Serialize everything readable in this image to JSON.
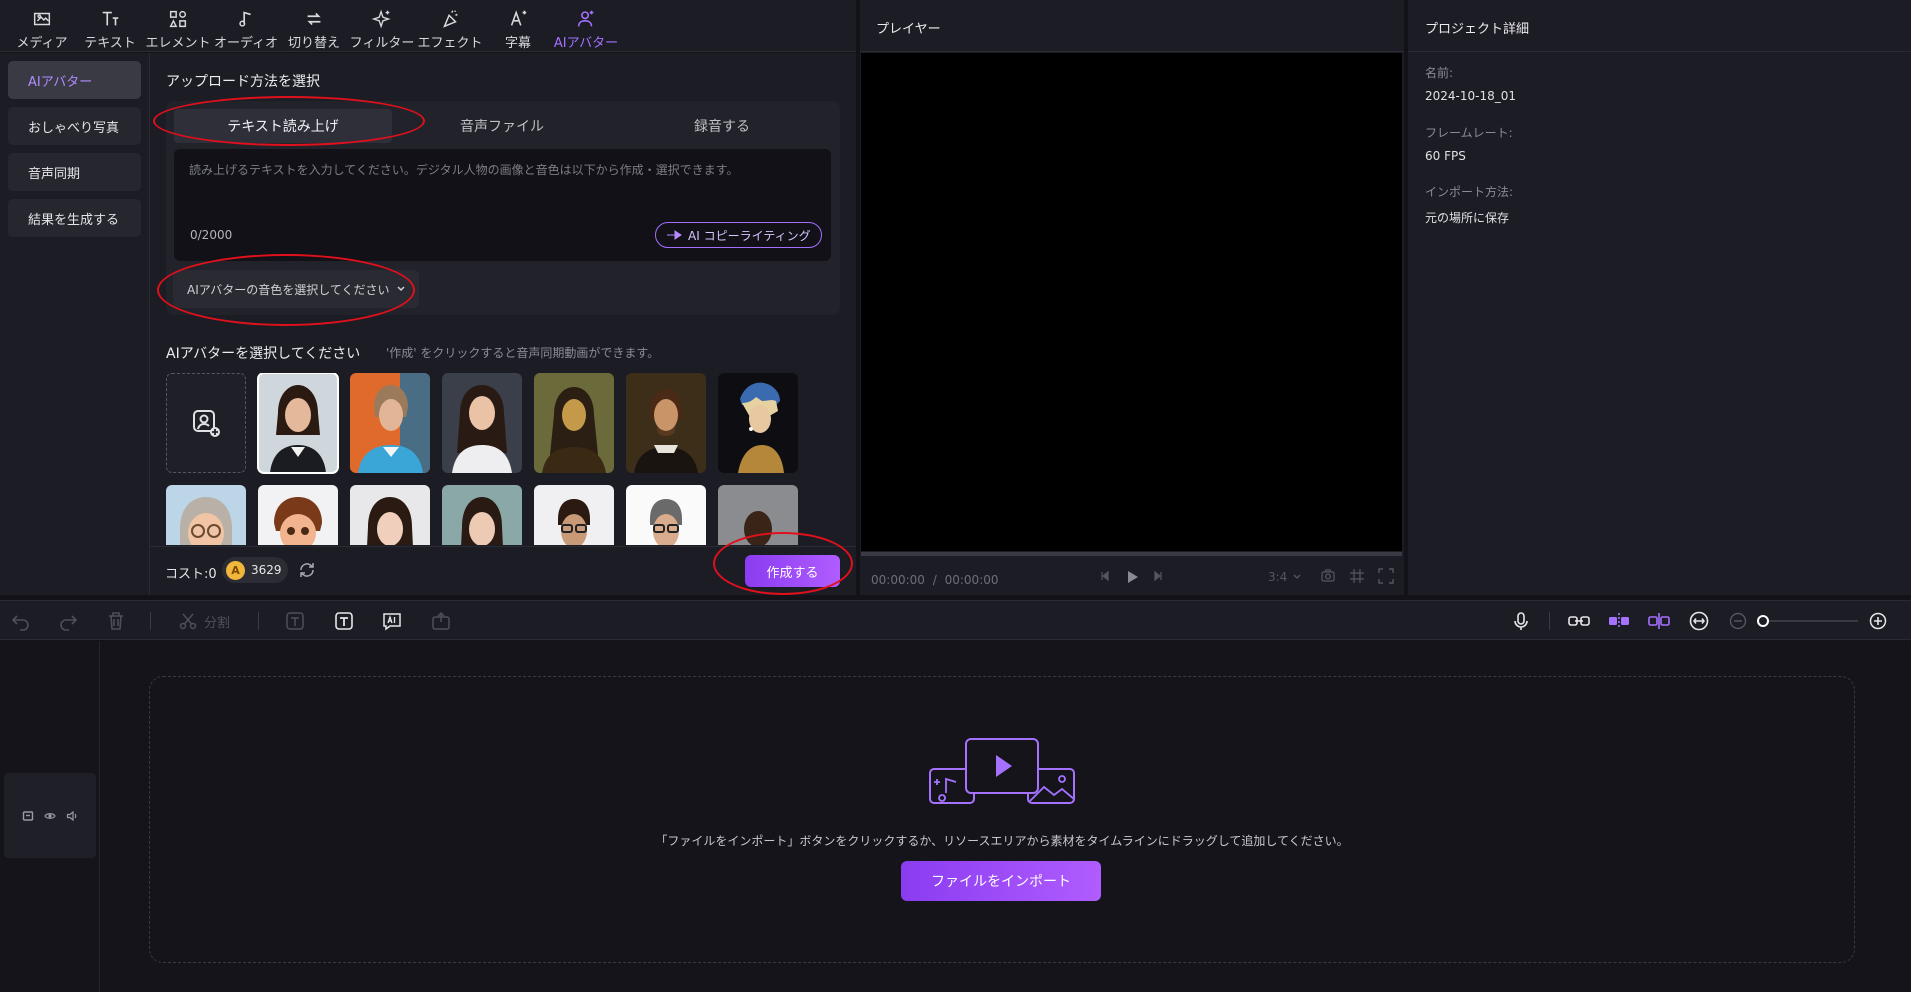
{
  "nav": [
    {
      "label": "メディア",
      "icon": "media-icon"
    },
    {
      "label": "テキスト",
      "icon": "text-icon"
    },
    {
      "label": "エレメント",
      "icon": "element-icon"
    },
    {
      "label": "オーディオ",
      "icon": "audio-icon"
    },
    {
      "label": "切り替え",
      "icon": "transition-icon"
    },
    {
      "label": "フィルター",
      "icon": "filter-icon"
    },
    {
      "label": "エフェクト",
      "icon": "effect-icon"
    },
    {
      "label": "字幕",
      "icon": "subtitle-icon"
    },
    {
      "label": "AIアバター",
      "icon": "ai-avatar-icon",
      "active": true
    }
  ],
  "sidebar": {
    "items": [
      {
        "label": "AIアバター",
        "active": true
      },
      {
        "label": "おしゃべり写真"
      },
      {
        "label": "音声同期"
      },
      {
        "label": "結果を生成する"
      }
    ]
  },
  "upload": {
    "title": "アップロード方法を選択",
    "tabs": [
      "テキスト読み上げ",
      "音声ファイル",
      "録音する"
    ],
    "active_tab": 0,
    "placeholder": "読み上げるテキストを入力してください。デジタル人物の画像と音色は以下から作成・選択できます。",
    "counter": "0/2000",
    "ai_copy": "AI コピーライティング",
    "voice_select": "AIアバターの音色を選択してください"
  },
  "avatars": {
    "title": "AIアバターを選択してください",
    "hint": "'作成' をクリックすると音声同期動画ができます。",
    "items": [
      "upload",
      "woman-business",
      "woman-short-hair",
      "woman-long-hair",
      "mona-lisa",
      "shakespeare",
      "pearl-earring",
      "cartoon-glasses-woman",
      "cartoon-boy",
      "asian-woman-1",
      "asian-woman-2",
      "man-glasses",
      "man-gray-glasses",
      "man-dark-suit"
    ],
    "selected": 1
  },
  "cost": {
    "label": "コスト:0",
    "coins": "3629",
    "create": "作成する"
  },
  "player": {
    "title": "プレイヤー",
    "time": "00:00:00",
    "duration": "00:00:00",
    "ratio": "3:4"
  },
  "details": {
    "title": "プロジェクト詳細",
    "name_label": "名前:",
    "name": "2024-10-18_01",
    "fps_label": "フレームレート:",
    "fps": "60 FPS",
    "import_label": "インポート方法:",
    "import_method": "元の場所に保存"
  },
  "toolbar": {
    "split": "分割"
  },
  "timeline": {
    "drop_text": "「ファイルをインポート」ボタンをクリックするか、リソースエリアから素材をタイムラインにドラッグして追加してください。",
    "import_button": "ファイルをインポート"
  },
  "colors": {
    "accent": "#a571ff",
    "button_gradient_start": "#8a3cf0",
    "button_gradient_end": "#b05cff",
    "annotation": "#e0101c"
  }
}
